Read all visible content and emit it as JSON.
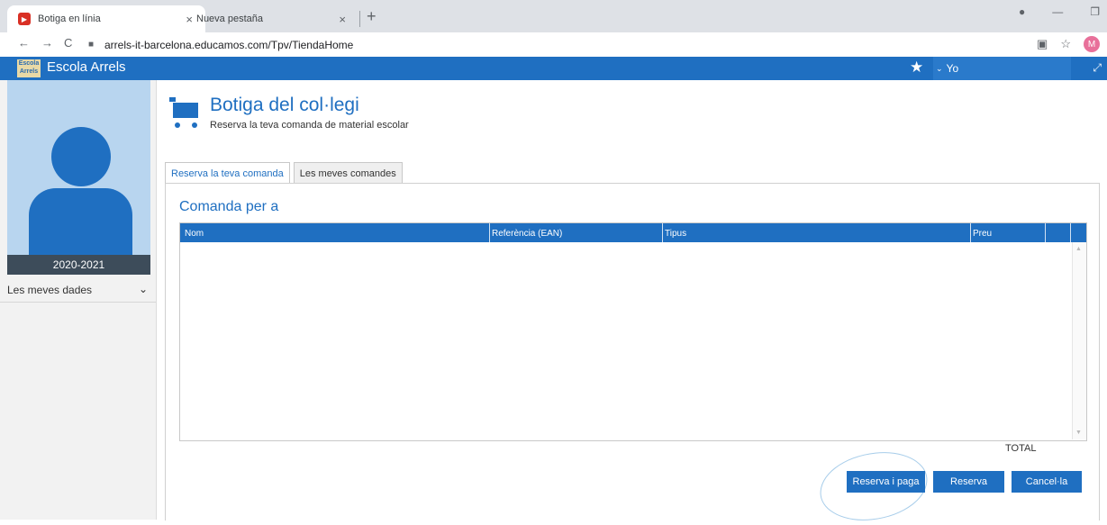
{
  "browser": {
    "tabs": [
      {
        "title": "Botiga en línia",
        "active": true
      },
      {
        "title": "Nueva pestaña",
        "active": false
      }
    ],
    "url": "arrels-it-barcelona.educamos.com/Tpv/TiendaHome",
    "profile_initial": "M",
    "new_tab_symbol": "+"
  },
  "app": {
    "logo_text": "Escola Arrels",
    "title": "Escola Arrels",
    "user_menu_label": "Yo"
  },
  "sidebar": {
    "school_year": "2020-2021",
    "menu": [
      {
        "label": "Les meves dades"
      }
    ]
  },
  "main": {
    "title": "Botiga del col·legi",
    "subtitle": "Reserva la teva comanda de material escolar",
    "tabs": [
      {
        "label": "Reserva la teva comanda",
        "active": true
      },
      {
        "label": "Les meves comandes",
        "active": false
      }
    ],
    "order_for_label": "Comanda per a",
    "table": {
      "columns": [
        "Nom",
        "Referència (EAN)",
        "Tipus",
        "Preu"
      ],
      "rows": []
    },
    "total_label": "TOTAL",
    "buttons": {
      "reserve_and_pay": "Reserva i paga",
      "reserve": "Reserva",
      "cancel": "Cancel·la"
    }
  },
  "colors": {
    "brand_blue": "#1f6fc1",
    "sidebar_bg": "#f2f2f2",
    "profile_bg": "#b8d5ef",
    "year_bar": "#3d4c5a"
  }
}
